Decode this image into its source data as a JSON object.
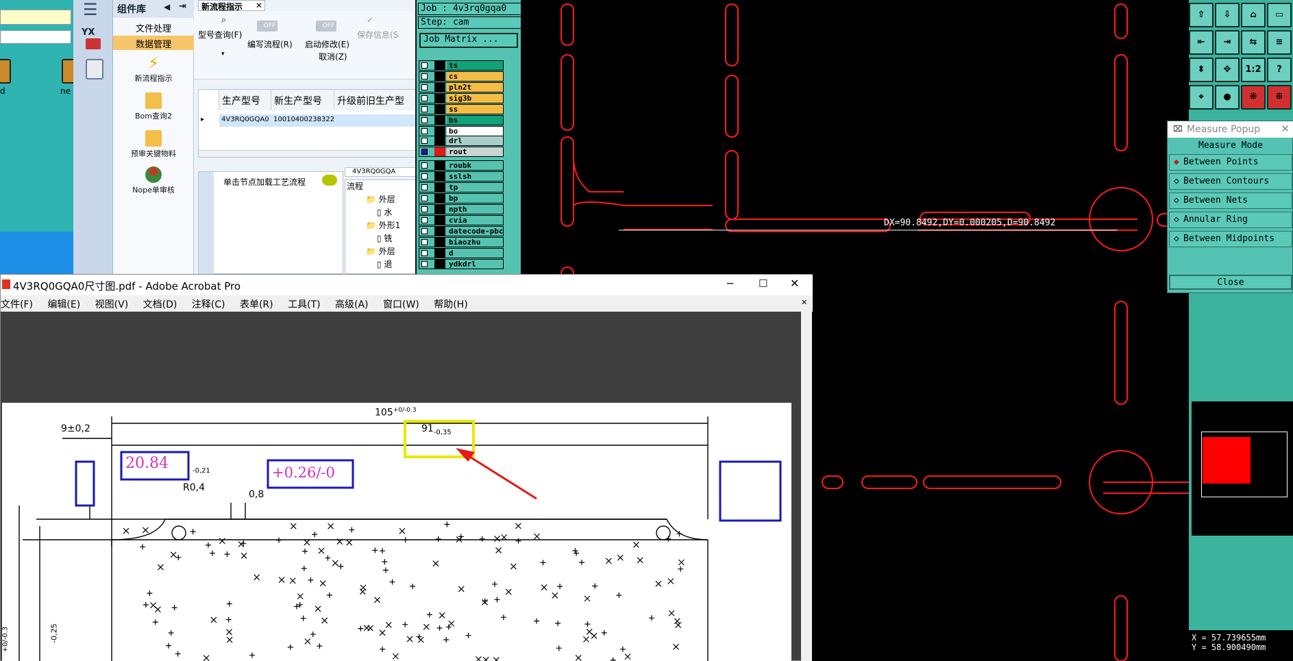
{
  "yx": {
    "nav_logo": "YX",
    "module_header": "组件库",
    "module_buttons": [
      "文件处理",
      "数据管理"
    ],
    "module_items": [
      "新流程指示",
      "Bom查询2",
      "预审关键物料",
      "Nope单审核"
    ],
    "tab_title": "新流程指示",
    "toolbar": {
      "query_label": "型号查询(F)",
      "edit_label": "编写流程(R)",
      "start_label": "启动修改(E)",
      "cancel_label": "取消(Z)",
      "save_label": "保存信息(S",
      "toggle_off": "OFF"
    },
    "table": {
      "headers": [
        "生产型号",
        "新生产型号",
        "升级前旧生产型"
      ],
      "row": [
        "4V3RQ0GQA0",
        "10010400238322"
      ]
    },
    "bottom_tab": "单击节点加载工艺流程",
    "bottom_side_tab": "4V3RQ0GQA",
    "tree_title": "流程",
    "tree_items": [
      "外层",
      "水",
      "外形1",
      "铣",
      "外层",
      "退"
    ]
  },
  "desktop": {
    "icon_labels": [
      "d",
      "ne"
    ]
  },
  "matrix": {
    "job_label": "Job : 4v3rq0gqa0",
    "step_label": "Step: cam",
    "matrix_button": "Job Matrix ...",
    "layers_a": [
      "ts",
      "cs",
      "pln2t",
      "sig3b",
      "ss",
      "bs",
      "bo"
    ],
    "layers_b": [
      "drl",
      "rout"
    ],
    "layers_c": [
      "roubk",
      "sslsh",
      "tp",
      "bp",
      "npth",
      "cvia",
      "datecode-pbc",
      "biaozhu",
      "d",
      "ydkdrl"
    ]
  },
  "canvas": {
    "measure_readout": "DX=90.8492,DY=0.000205,D=90.8492",
    "coord_x": "X = 57.739655mm",
    "coord_y": "Y = 58.900490mm"
  },
  "measure_popup": {
    "title": "Measure Popup",
    "mode_label": "Measure Mode",
    "options": [
      "Between Points",
      "Between Contours",
      "Between Nets",
      "Annular Ring",
      "Between Midpoints"
    ],
    "close_label": "Close"
  },
  "acrobat": {
    "title": "4V3RQ0GQA0尺寸图.pdf - Adobe Acrobat Pro",
    "menu": [
      "文件(F)",
      "编辑(E)",
      "视图(V)",
      "文档(D)",
      "注释(C)",
      "表单(R)",
      "工具(T)",
      "高级(A)",
      "窗口(W)",
      "帮助(H)"
    ]
  },
  "drawing": {
    "dim_overall": "105",
    "dim_overall_tol": "+0/-0.3",
    "dim_left": "9±0,2",
    "dim_center": "91",
    "dim_center_tol": "-0,35",
    "annot_measured": "20.84",
    "dim_small_tol": "-0,21",
    "annot_tol": "+0.26/-0",
    "radius": "R0,4",
    "dim_08": "0,8",
    "side_tol": "-0,25",
    "side_tol2": "+0/-0.3"
  },
  "colors": {
    "cam_red": "#ff1b1b",
    "teal": "#56c3b0",
    "highlight_yellow": "#e8e800",
    "annot_blue": "#1818b8",
    "annot_magenta": "#d030c0",
    "arrow_red": "#e21a1a"
  }
}
